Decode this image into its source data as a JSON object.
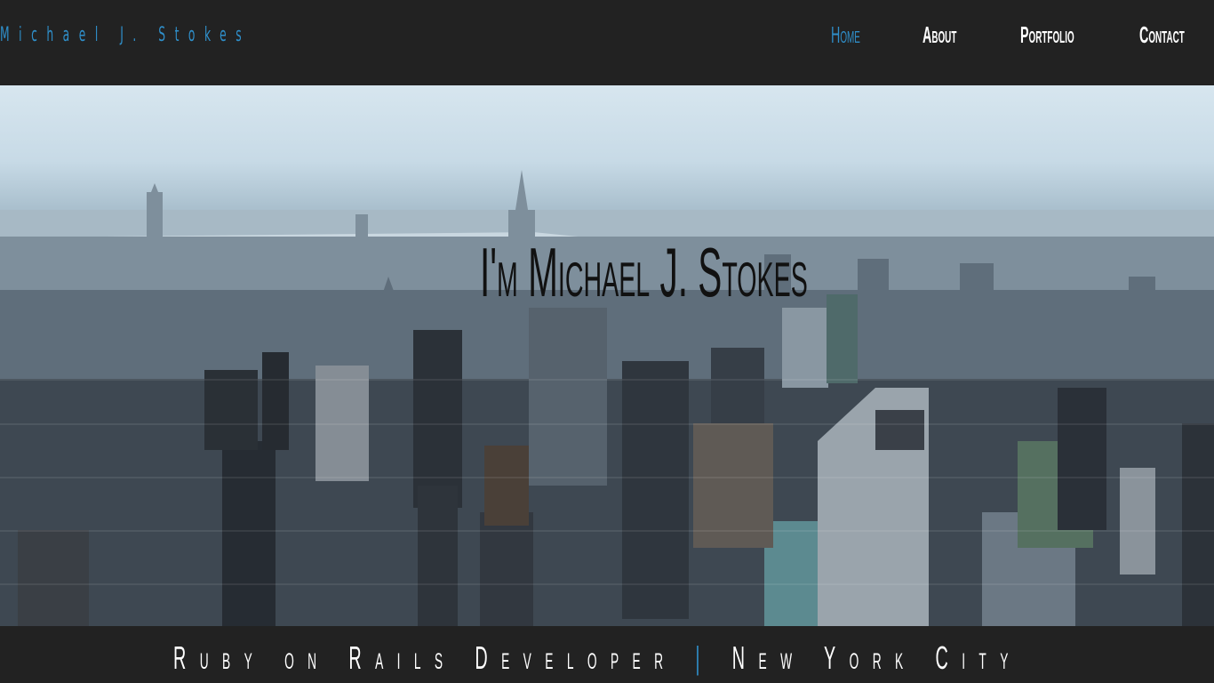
{
  "brand": {
    "name": "Michael J. Stokes"
  },
  "nav": {
    "items": [
      {
        "label": "Home",
        "active": true
      },
      {
        "label": "About",
        "active": false
      },
      {
        "label": "Portfolio",
        "active": false
      },
      {
        "label": "Contact",
        "active": false
      }
    ]
  },
  "hero": {
    "title": "I'm Michael J. Stokes",
    "background": "new-york-city-skyline-aerial"
  },
  "tagline": {
    "role": "Ruby on Rails Developer",
    "separator": "|",
    "location": "New York City"
  },
  "colors": {
    "accent": "#2f8fca",
    "nav_bg": "#222222",
    "text_light": "#ffffff",
    "title_dark": "#111111"
  }
}
